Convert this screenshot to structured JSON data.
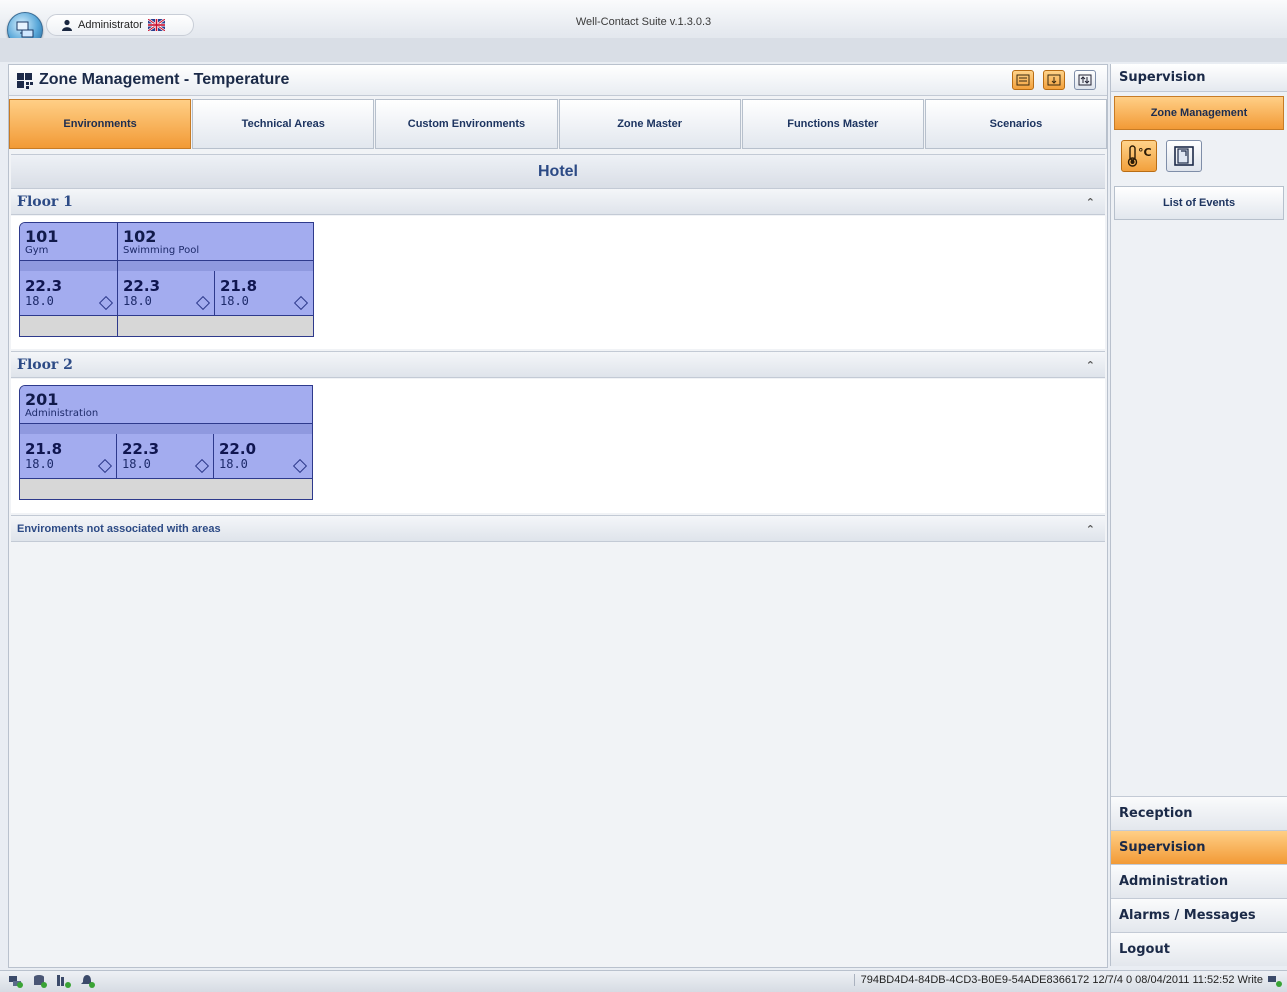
{
  "window": {
    "title": "Well-Contact Suite v.1.3.0.3",
    "user": "Administrator"
  },
  "panel": {
    "title": "Zone Management - Temperature",
    "header_buttons": [
      "name-view-icon",
      "sort-down-icon",
      "sort-updown-icon"
    ]
  },
  "tabs": [
    {
      "label": "Environments",
      "active": true
    },
    {
      "label": "Technical Areas",
      "active": false
    },
    {
      "label": "Custom Environments",
      "active": false
    },
    {
      "label": "Zone Master",
      "active": false
    },
    {
      "label": "Functions Master",
      "active": false
    },
    {
      "label": "Scenarios",
      "active": false
    }
  ],
  "building": "Hotel",
  "floors": [
    {
      "name": "Floor 1",
      "rooms": [
        {
          "number": "101",
          "name": "Gym",
          "readings": [
            {
              "temp": "22.3",
              "set": "18.0"
            }
          ]
        },
        {
          "number": "102",
          "name": "Swimming Pool",
          "readings": [
            {
              "temp": "22.3",
              "set": "18.0"
            },
            {
              "temp": "21.8",
              "set": "18.0"
            }
          ]
        }
      ]
    },
    {
      "name": "Floor 2",
      "rooms": [
        {
          "number": "201",
          "name": "Administration",
          "readings": [
            {
              "temp": "21.8",
              "set": "18.0"
            },
            {
              "temp": "22.3",
              "set": "18.0"
            },
            {
              "temp": "22.0",
              "set": "18.0"
            }
          ]
        }
      ]
    }
  ],
  "unassociated_label": "Enviroments not associated with areas",
  "sidebar": {
    "title": "Supervision",
    "zone_management": "Zone Management",
    "list_of_events": "List of Events",
    "nav": [
      {
        "label": "Reception",
        "active": false
      },
      {
        "label": "Supervision",
        "active": true
      },
      {
        "label": "Administration",
        "active": false
      },
      {
        "label": "Alarms / Messages",
        "active": false
      },
      {
        "label": "Logout",
        "active": false
      }
    ]
  },
  "status": {
    "text": "794BD4D4-84DB-4CD3-B0E9-54ADE8366172 12/7/4 0 08/04/2011 11:52:52 Write"
  },
  "colors": {
    "accent_orange": "#f29a36",
    "room_card": "#a3acef",
    "heading_blue": "#2c4a85"
  }
}
